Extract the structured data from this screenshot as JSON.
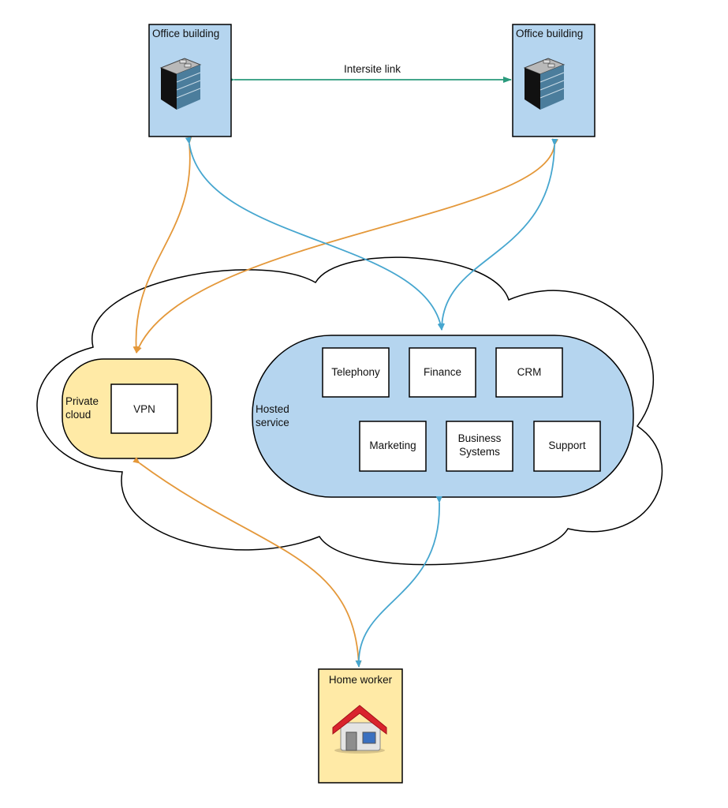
{
  "colors": {
    "office_fill": "#b5d5ef",
    "private_fill": "#ffeaa6",
    "hosted_fill": "#b5d5ef",
    "orange_link": "#e4983a",
    "blue_link": "#46a6cf",
    "teal_link": "#2a9a7c"
  },
  "sites": {
    "office_left": {
      "label": "Office building",
      "icon": "office-building-icon"
    },
    "office_right": {
      "label": "Office building",
      "icon": "office-building-icon"
    },
    "home": {
      "label": "Home worker",
      "icon": "house-icon"
    }
  },
  "intersite_link": "Intersite link",
  "private_cloud": {
    "label_line1": "Private",
    "label_line2": "cloud",
    "vpn": "VPN"
  },
  "hosted_service": {
    "label_line1": "Hosted",
    "label_line2": "service",
    "services": [
      "Telephony",
      "Finance",
      "CRM",
      "Marketing",
      "Business",
      "Systems",
      "Support"
    ]
  }
}
